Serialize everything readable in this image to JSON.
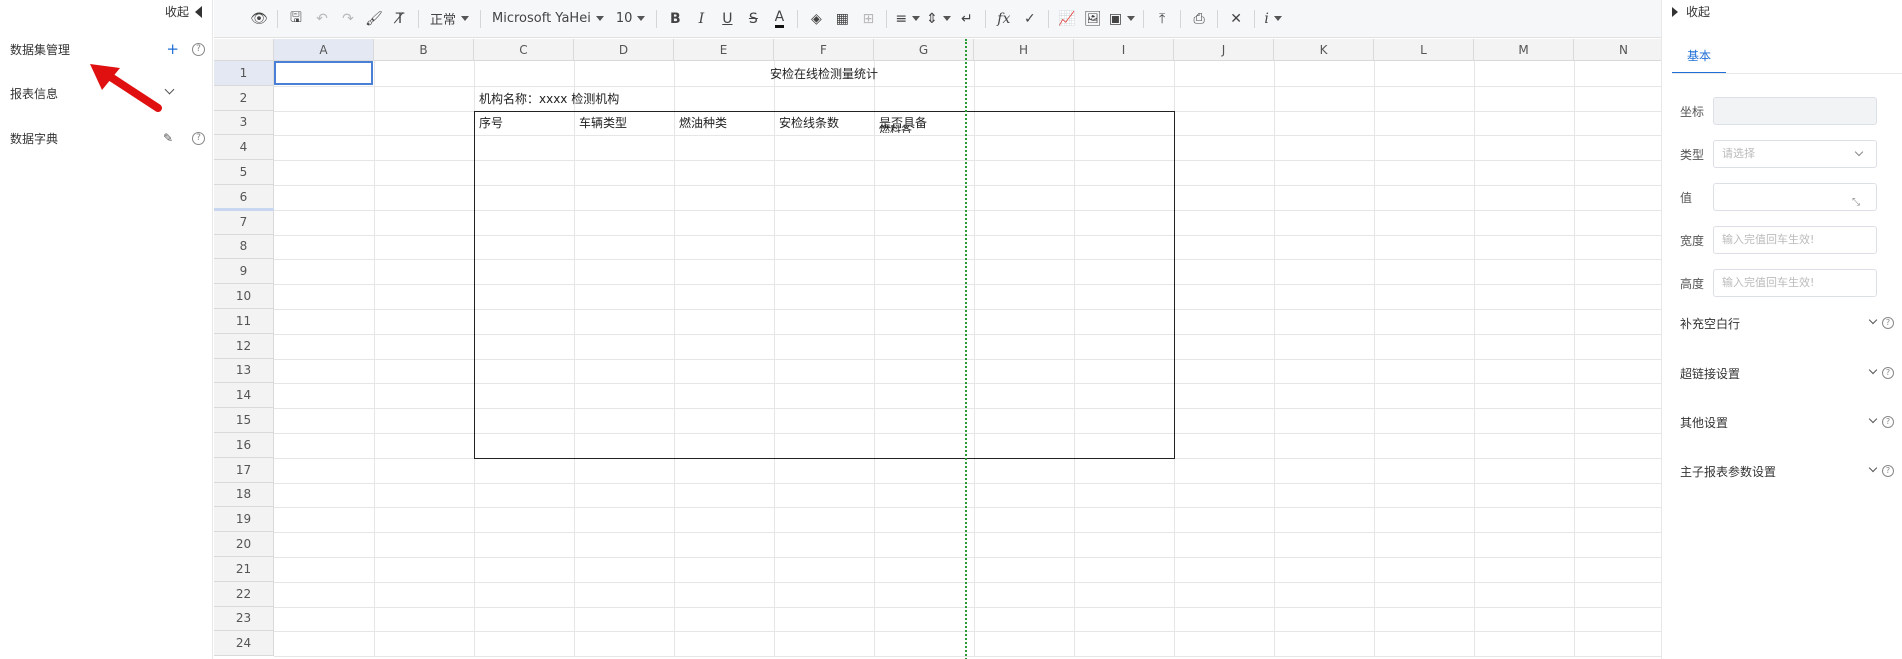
{
  "left_panel": {
    "collapse_label": "收起",
    "items": [
      {
        "label": "数据集管理",
        "action": "plus-icon",
        "help": "?"
      },
      {
        "label": "报表信息",
        "action": "chevron-down-icon"
      },
      {
        "label": "数据字典",
        "action": "pencil-icon",
        "help": "?"
      }
    ]
  },
  "toolbar": {
    "items": [
      {
        "name": "preview-icon",
        "glyph": "👁"
      },
      {
        "name": "sep"
      },
      {
        "name": "save-icon",
        "glyph": "🖫"
      },
      {
        "name": "undo-icon",
        "glyph": "↶",
        "disabled": true
      },
      {
        "name": "redo-icon",
        "glyph": "↷",
        "disabled": true
      },
      {
        "name": "format-painter-icon",
        "glyph": "🖌"
      },
      {
        "name": "clear-format-icon",
        "glyph": "T̸"
      },
      {
        "name": "sep"
      },
      {
        "name": "number-format-select",
        "text": "正常",
        "dropdown": true
      },
      {
        "name": "sep"
      },
      {
        "name": "font-family-select",
        "text": "Microsoft YaHei",
        "dropdown": true
      },
      {
        "name": "font-size-select",
        "text": "10",
        "dropdown": true
      },
      {
        "name": "sep"
      },
      {
        "name": "bold-icon",
        "glyph": "B"
      },
      {
        "name": "italic-icon",
        "glyph": "I"
      },
      {
        "name": "underline-icon",
        "glyph": "U"
      },
      {
        "name": "strikethrough-icon",
        "glyph": "S"
      },
      {
        "name": "font-color-icon",
        "glyph": "A"
      },
      {
        "name": "sep"
      },
      {
        "name": "fill-color-icon",
        "glyph": "◈"
      },
      {
        "name": "borders-icon",
        "glyph": "▦"
      },
      {
        "name": "merge-cells-icon",
        "glyph": "⊞",
        "disabled": true
      },
      {
        "name": "sep"
      },
      {
        "name": "horizontal-align-icon",
        "glyph": "≡",
        "dropdown": true
      },
      {
        "name": "vertical-align-icon",
        "glyph": "⇕",
        "dropdown": true
      },
      {
        "name": "text-wrap-icon",
        "glyph": "↵"
      },
      {
        "name": "sep"
      },
      {
        "name": "formula-icon",
        "glyph": "fx"
      },
      {
        "name": "data-validation-icon",
        "glyph": "✓"
      },
      {
        "name": "sep"
      },
      {
        "name": "chart-icon",
        "glyph": "📈"
      },
      {
        "name": "image-icon",
        "glyph": "🖼"
      },
      {
        "name": "qrcode-icon",
        "glyph": "▣",
        "dropdown": true
      },
      {
        "name": "sep"
      },
      {
        "name": "upload-icon",
        "glyph": "⤒"
      },
      {
        "name": "sep"
      },
      {
        "name": "print-icon",
        "glyph": "⎙"
      },
      {
        "name": "sep"
      },
      {
        "name": "tools-icon",
        "glyph": "✕"
      },
      {
        "name": "sep"
      },
      {
        "name": "info-icon",
        "glyph": "i",
        "dropdown": true
      }
    ]
  },
  "sheet": {
    "columns": [
      "A",
      "B",
      "C",
      "D",
      "E",
      "F",
      "G",
      "H",
      "I",
      "J",
      "K",
      "L",
      "M",
      "N"
    ],
    "rows": [
      "1",
      "2",
      "3",
      "4",
      "5",
      "6",
      "7",
      "8",
      "9",
      "10",
      "11",
      "12",
      "13",
      "14",
      "15",
      "16",
      "17",
      "18",
      "19",
      "20",
      "21",
      "22",
      "23",
      "24"
    ],
    "title": "安检在线检测量统计",
    "org_line": "机构名称：xxxx 检测机构",
    "headers": [
      "序号",
      "车辆类型",
      "燃油种类",
      "安检线条数",
      "是否具备"
    ],
    "header_overflow": "燃料各"
  },
  "right_panel": {
    "collapse_label": "收起",
    "tab": "基本",
    "fields": [
      {
        "label": "坐标",
        "placeholder": "",
        "kind": "disabled"
      },
      {
        "label": "类型",
        "placeholder": "请选择",
        "kind": "select"
      },
      {
        "label": "值",
        "placeholder": "",
        "kind": "expand"
      },
      {
        "label": "宽度",
        "placeholder": "输入完值回车生效!",
        "kind": "text"
      },
      {
        "label": "高度",
        "placeholder": "输入完值回车生效!",
        "kind": "text"
      }
    ],
    "sections": [
      "补充空白行",
      "超链接设置",
      "其他设置",
      "主子报表参数设置"
    ]
  }
}
